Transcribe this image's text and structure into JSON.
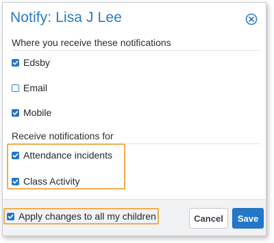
{
  "dialog": {
    "title": "Notify: Lisa J Lee",
    "close_icon": "close-circle-icon"
  },
  "receive_section": {
    "heading": "Where you receive these notifications",
    "options": [
      {
        "label": "Edsby",
        "checked": true
      },
      {
        "label": "Email",
        "checked": false
      },
      {
        "label": "Mobile",
        "checked": true
      }
    ]
  },
  "notify_section": {
    "heading": "Receive notifications for",
    "options": [
      {
        "label": "Attendance incidents",
        "checked": true
      },
      {
        "label": "Class Activity",
        "checked": true
      }
    ]
  },
  "footer": {
    "apply_all": {
      "label": "Apply changes to all my children",
      "checked": true
    },
    "cancel_label": "Cancel",
    "save_label": "Save"
  },
  "colors": {
    "accent": "#2377c9",
    "title": "#2b78c2",
    "highlight": "#f0ad4e",
    "footer_bg": "#f1f2f4"
  }
}
